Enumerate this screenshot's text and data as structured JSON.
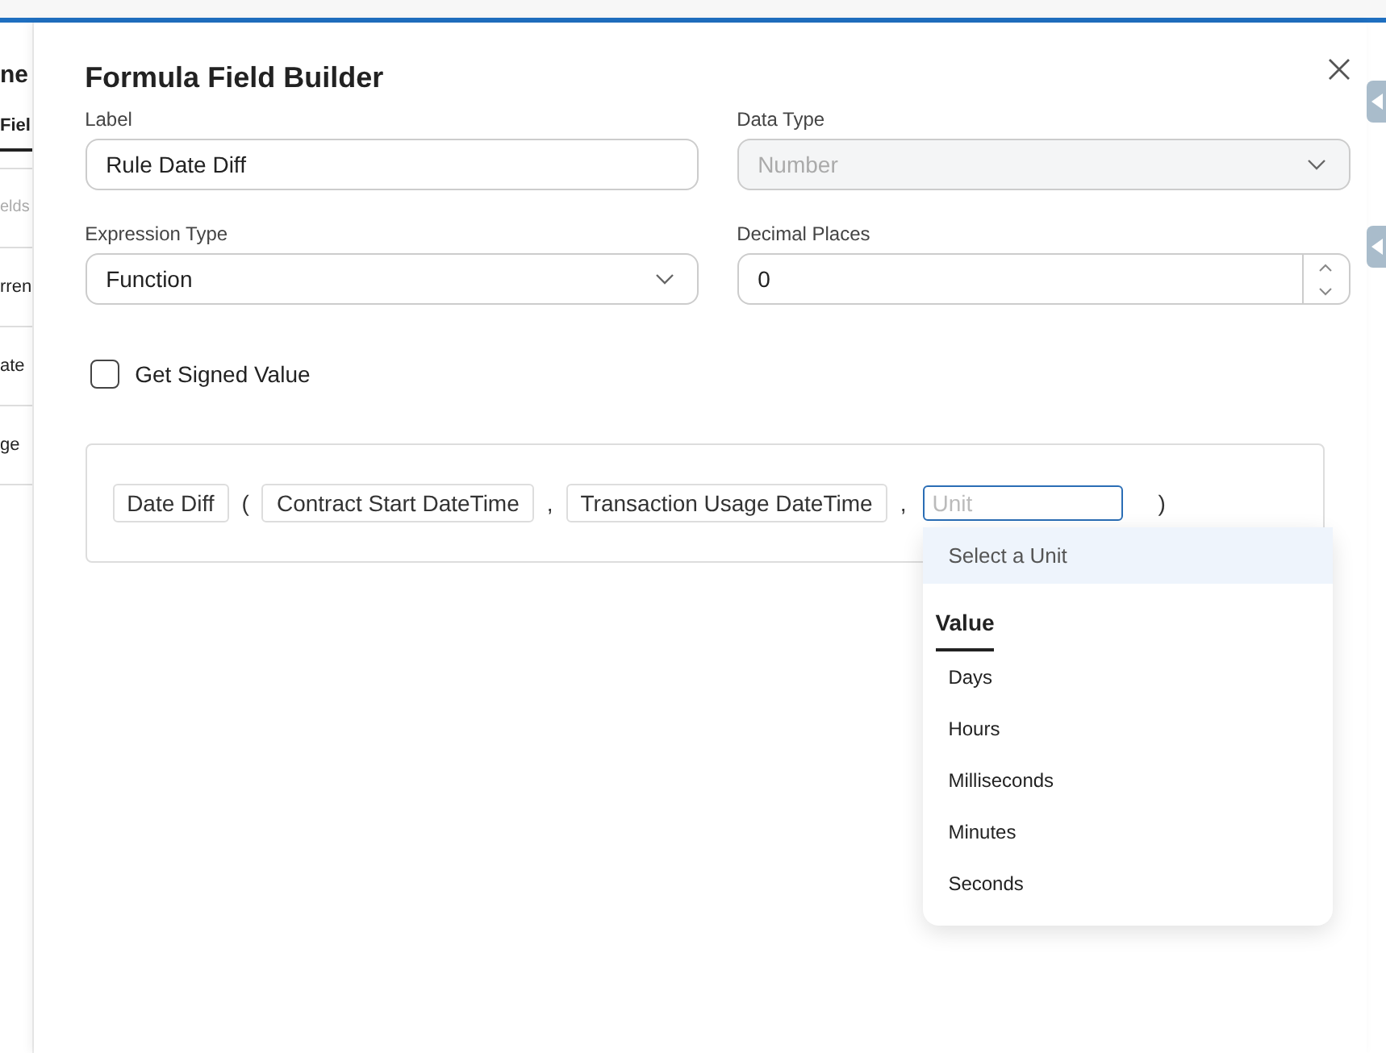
{
  "background": {
    "fragments": [
      {
        "kind": "heading",
        "text": "ne"
      },
      {
        "kind": "tab",
        "text": "Fiel"
      },
      {
        "kind": "hint",
        "text": "elds"
      },
      {
        "kind": "row",
        "text": "rren"
      },
      {
        "kind": "row",
        "text": "ate"
      },
      {
        "kind": "row",
        "text": "ge"
      }
    ]
  },
  "modal": {
    "title": "Formula Field Builder",
    "fields": [
      {
        "kind": "text",
        "label": "Label",
        "value": "Rule Date Diff",
        "disabled": false
      },
      {
        "kind": "select",
        "label": "Data Type",
        "value": "Number",
        "disabled": true
      },
      {
        "kind": "select",
        "label": "Expression Type",
        "value": "Function",
        "disabled": false
      },
      {
        "kind": "number",
        "label": "Decimal Places",
        "value": "0",
        "disabled": false
      }
    ],
    "checkbox": {
      "label": "Get Signed Value",
      "checked": false
    },
    "expression": [
      {
        "kind": "chip",
        "text": "Date Diff"
      },
      {
        "kind": "punct",
        "text": "("
      },
      {
        "kind": "chip",
        "text": "Contract Start DateTime"
      },
      {
        "kind": "punct",
        "text": ","
      },
      {
        "kind": "chip",
        "text": "Transaction Usage DateTime"
      },
      {
        "kind": "punct",
        "text": ","
      },
      {
        "kind": "input",
        "placeholder": "Unit"
      },
      {
        "kind": "punct",
        "text": ")"
      }
    ],
    "dropdown": {
      "header": "Select a Unit",
      "tabs": [
        {
          "label": "Value",
          "selected": true
        }
      ],
      "options": [
        "Days",
        "Hours",
        "Milliseconds",
        "Minutes",
        "Seconds"
      ]
    }
  }
}
